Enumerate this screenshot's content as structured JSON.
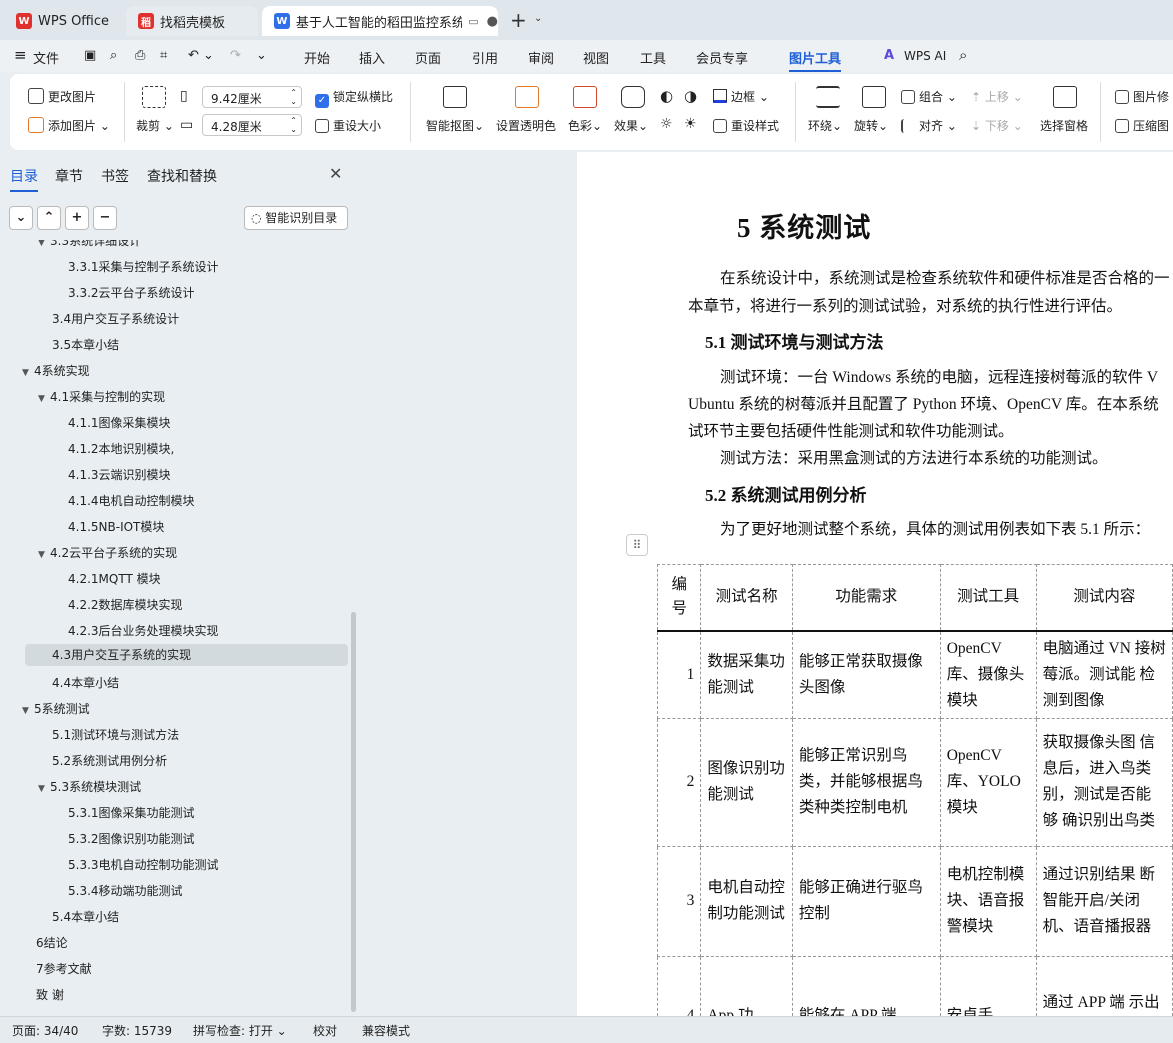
{
  "tabs": [
    {
      "label": "WPS Office"
    },
    {
      "label": "找稻壳模板"
    },
    {
      "label": "基于人工智能的稻田监控系统"
    }
  ],
  "menu": {
    "file": "文件",
    "items": [
      "开始",
      "插入",
      "页面",
      "引用",
      "审阅",
      "视图",
      "工具",
      "会员专享"
    ],
    "active": "图片工具",
    "ai": "WPS AI"
  },
  "ribbon": {
    "change_pic": "更改图片",
    "add_pic": "添加图片",
    "crop": "裁剪",
    "width_value": "9.42厘米",
    "height_value": "4.28厘米",
    "lock_ratio": "锁定纵横比",
    "resize": "重设大小",
    "smart_cutout": "智能抠图",
    "set_transparent": "设置透明色",
    "color": "色彩",
    "effect": "效果",
    "border": "边框",
    "reset_style": "重设样式",
    "wrap": "环绕",
    "rotate": "旋转",
    "group": "组合",
    "move_up": "上移",
    "align": "对齐",
    "move_down": "下移",
    "select_pane": "选择窗格",
    "pic_fix": "图片修",
    "compress": "压缩图"
  },
  "panel": {
    "tabs": [
      "目录",
      "章节",
      "书签",
      "查找和替换"
    ],
    "smart_toc": "智能识别目录",
    "toc": [
      {
        "label": "3.3系统详细设计",
        "level": 1
      },
      {
        "label": "3.3.1采集与控制子系统设计",
        "level": 2
      },
      {
        "label": "3.3.2云平台子系统设计",
        "level": 2
      },
      {
        "label": "3.4用户交互子系统设计",
        "level": 1
      },
      {
        "label": "3.5本章小结",
        "level": 1
      },
      {
        "label": "4系统实现",
        "level": 0
      },
      {
        "label": "4.1采集与控制的实现",
        "level": 1
      },
      {
        "label": "4.1.1图像采集模块",
        "level": 2
      },
      {
        "label": "4.1.2本地识别模块,",
        "level": 2
      },
      {
        "label": "4.1.3云端识别模块",
        "level": 2
      },
      {
        "label": "4.1.4电机自动控制模块",
        "level": 2
      },
      {
        "label": "4.1.5NB-IOT模块",
        "level": 2
      },
      {
        "label": "4.2云平台子系统的实现",
        "level": 1
      },
      {
        "label": "4.2.1MQTT 模块",
        "level": 2
      },
      {
        "label": "4.2.2数据库模块实现",
        "level": 2
      },
      {
        "label": "4.2.3后台业务处理模块实现",
        "level": 2
      },
      {
        "label": "4.3用户交互子系统的实现",
        "level": 1
      },
      {
        "label": "4.4本章小结",
        "level": 1
      },
      {
        "label": "5系统测试",
        "level": 0
      },
      {
        "label": "5.1测试环境与测试方法",
        "level": 1
      },
      {
        "label": "5.2系统测试用例分析",
        "level": 1
      },
      {
        "label": "5.3系统模块测试",
        "level": 1
      },
      {
        "label": "5.3.1图像采集功能测试",
        "level": 2
      },
      {
        "label": "5.3.2图像识别功能测试",
        "level": 2
      },
      {
        "label": "5.3.3电机自动控制功能测试",
        "level": 2
      },
      {
        "label": "5.3.4移动端功能测试",
        "level": 2
      },
      {
        "label": "5.4本章小结",
        "level": 1
      },
      {
        "label": "6结论",
        "level": 0
      },
      {
        "label": "7参考文献",
        "level": 0
      },
      {
        "label": "致  谢",
        "level": 0
      }
    ]
  },
  "doc": {
    "chapter_title": "5  系统测试",
    "p1_l1": "在系统设计中，系统测试是检查系统软件和硬件标准是否合格的一",
    "p1_l2": "本章节，将进行一系列的测试试验，对系统的执行性进行评估。",
    "h51": "5.1   测试环境与测试方法",
    "p2_l1": "测试环境：一台 Windows 系统的电脑，远程连接树莓派的软件 V",
    "p2_l2": "Ubuntu 系统的树莓派并且配置了 Python 环境、OpenCV 库。在本系统",
    "p2_l3": "试环节主要包括硬件性能测试和软件功能测试。",
    "p3": "测试方法：采用黑盒测试的方法进行本系统的功能测试。",
    "h52": "5.2   系统测试用例分析",
    "p4": "为了更好地测试整个系统，具体的测试用例表如下表 5.1 所示：",
    "table": {
      "headers": [
        "编号",
        "测试名称",
        "功能需求",
        "测试工具",
        "测试内容"
      ],
      "rows": [
        [
          "1",
          "数据采集功能测试",
          "能够正常获取摄像头图像",
          "OpenCV库、摄像头模块",
          "电脑通过 VN 接树莓派。测试能 检测到图像"
        ],
        [
          "2",
          "图像识别功能测试",
          "能够正常识别鸟类，并能够根据鸟类种类控制电机",
          "OpenCV库、YOLO 模块",
          "获取摄像头图 信息后，进入鸟类 别，测试是否能够 确识别出鸟类"
        ],
        [
          "3",
          "电机自动控制功能测试",
          "能够正确进行驱鸟控制",
          "电机控制模块、语音报警模块",
          "通过识别结果 断智能开启/关闭 机、语音播报器"
        ],
        [
          "4",
          "App 功",
          "能够在 APP 端",
          "安卓手",
          "通过 APP 端 示出稻田异常信息"
        ]
      ]
    }
  },
  "status": {
    "page": "页面: 34/40",
    "words": "字数: 15739",
    "spell": "拼写检查: 打开",
    "proof": "校对",
    "compat": "兼容模式"
  }
}
